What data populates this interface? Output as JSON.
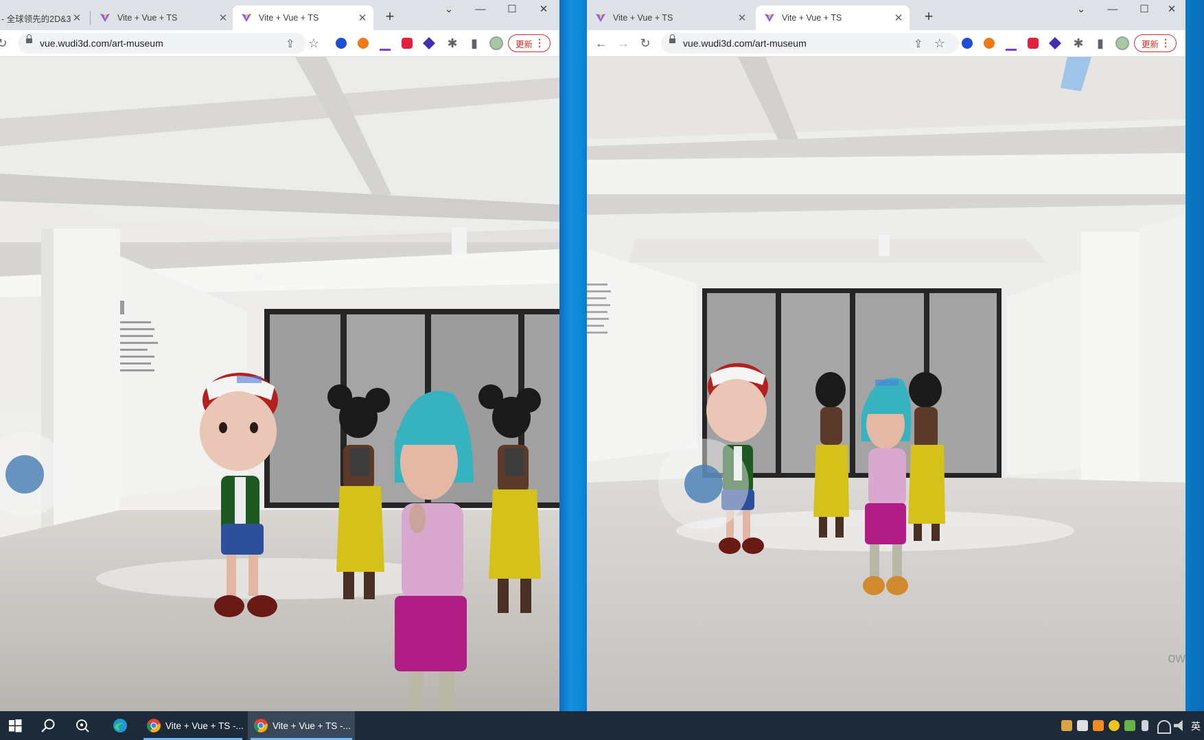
{
  "left_window": {
    "tabs": [
      {
        "title": "- 全球领先的2D&3",
        "active": false
      },
      {
        "title": "Vite + Vue + TS",
        "active": false
      },
      {
        "title": "Vite + Vue + TS",
        "active": true
      }
    ],
    "url": "vue.wudi3d.com/art-museum",
    "update_label": "更新"
  },
  "right_window": {
    "tabs": [
      {
        "title": "Vite + Vue + TS",
        "active": false
      },
      {
        "title": "Vite + Vue + TS",
        "active": true
      }
    ],
    "url": "vue.wudi3d.com/art-museum",
    "update_label": "更新",
    "watermark": "ow"
  },
  "taskbar": {
    "items": [
      {
        "label": "Vite + Vue + TS -...",
        "active": false
      },
      {
        "label": "Vite + Vue + TS -...",
        "active": true
      }
    ],
    "ime": "英"
  },
  "icons": {
    "close": "✕",
    "new_tab": "+",
    "min": "—",
    "max": "☐",
    "chev": "⌄",
    "back": "←",
    "forward": "→",
    "reload": "↻",
    "share": "⇪",
    "star": "☆",
    "puzzle": "✱",
    "sidepanel": "▮"
  },
  "colors": {
    "accent": "#1a73e8",
    "update": "#d93025",
    "desktop": "#0a84d6",
    "taskbar": "#1c2a3a"
  }
}
